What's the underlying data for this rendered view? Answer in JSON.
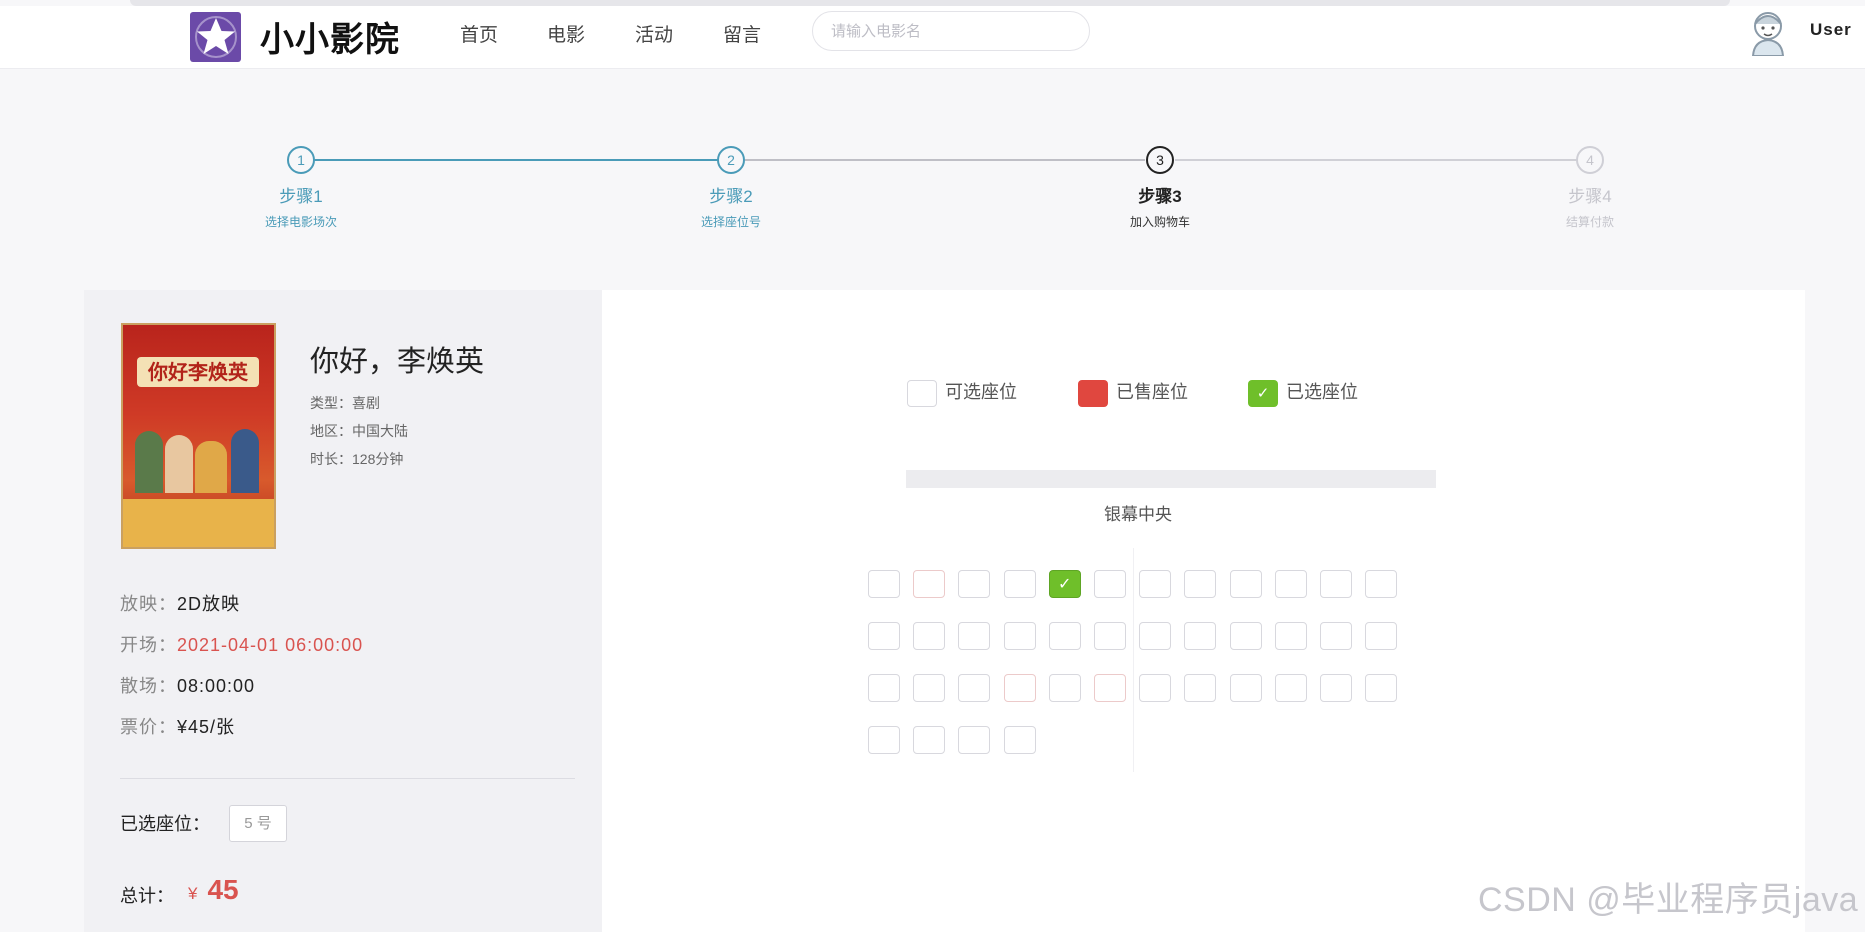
{
  "app": {
    "brand": "小小影院",
    "logo_icon": "star-icon",
    "nav": [
      {
        "label": "首页"
      },
      {
        "label": "电影"
      },
      {
        "label": "活动"
      },
      {
        "label": "留言"
      }
    ],
    "search_placeholder": "请输入电影名",
    "user": "User"
  },
  "steps": [
    {
      "num": "1",
      "title": "步骤1",
      "desc": "选择电影场次",
      "state": "done"
    },
    {
      "num": "2",
      "title": "步骤2",
      "desc": "选择座位号",
      "state": "done"
    },
    {
      "num": "3",
      "title": "步骤3",
      "desc": "加入购物车",
      "state": "active"
    },
    {
      "num": "4",
      "title": "步骤4",
      "desc": "结算付款",
      "state": "pending"
    }
  ],
  "movie": {
    "title": "你好，李焕英",
    "poster_text": "你好李焕英",
    "type_label": "类型：",
    "type": "喜剧",
    "region_label": "地区：",
    "region": "中国大陆",
    "duration_label": "时长：",
    "duration": "128分钟"
  },
  "session": {
    "format_label": "放映：",
    "format": "2D放映",
    "start_label": "开场：",
    "start": "2021-04-01 06:00:00",
    "end_label": "散场：",
    "end": "08:00:00",
    "price_label": "票价：",
    "price": "¥45/张"
  },
  "order": {
    "selected_label": "已选座位：",
    "selected_seat": "5 号",
    "total_label": "总计：",
    "currency": "¥",
    "total": "45"
  },
  "legend": {
    "available": "可选座位",
    "sold": "已售座位",
    "selected": "已选座位"
  },
  "screen_label": "银幕中央",
  "seat_rows": [
    [
      "available",
      "sold",
      "available",
      "available",
      "selected",
      "available",
      "available",
      "available",
      "available",
      "available",
      "available",
      "available"
    ],
    [
      "available",
      "available",
      "available",
      "available",
      "available",
      "available",
      "available",
      "available",
      "available",
      "available",
      "available",
      "available"
    ],
    [
      "available",
      "available",
      "available",
      "sold",
      "available",
      "sold",
      "available",
      "available",
      "available",
      "available",
      "available",
      "available"
    ],
    [
      "available",
      "available",
      "available",
      "available"
    ]
  ],
  "colors": {
    "accent": "#4a9bb8",
    "sold": "#e0473f",
    "selected": "#6fbf2a",
    "price": "#d9534f"
  },
  "watermark": "CSDN @毕业程序员java"
}
